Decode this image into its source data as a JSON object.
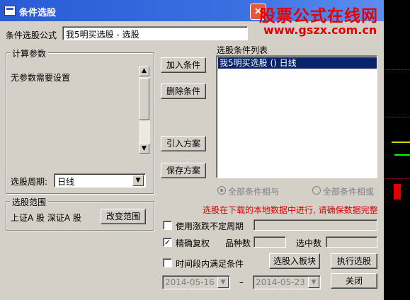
{
  "window": {
    "title": "条件选股",
    "close_label": "×"
  },
  "watermark": {
    "line1": "股票公式在线网",
    "line2": "www.gszx.com.cn"
  },
  "formula": {
    "label": "条件选股公式",
    "value": "我5明买选股 - 选股"
  },
  "params": {
    "group_label": "计算参数",
    "message": "无参数需要设置",
    "period_label": "选股周期:",
    "period_value": "日线"
  },
  "buttons": {
    "add": "加入条件",
    "delete": "删除条件",
    "import": "引入方案",
    "save": "保存方案",
    "change_range": "改变范围",
    "to_block": "选股入板块",
    "execute": "执行选股",
    "close": "关闭"
  },
  "condition_list": {
    "label": "选股条件列表",
    "items": [
      "我5明买选股  ()  日线"
    ]
  },
  "logic": {
    "and_label": "全部条件相与",
    "or_label": "全部条件相或"
  },
  "range": {
    "group_label": "选股范围",
    "value": "上证A 股  深证A 股"
  },
  "notice": "选股在下载的本地数据中进行, 请确保数据完整",
  "options": {
    "uncertain_period": "使用涨跌不定周期",
    "precise_restore": "精确复权",
    "time_range": "时间段内满足条件"
  },
  "stats": {
    "count_label": "品种数",
    "selected_label": "选中数"
  },
  "dates": {
    "start": "2014-05-16",
    "separator": "–",
    "end": "2014-05-23"
  },
  "icons": {
    "title": "window-icon",
    "scroll_up": "▲",
    "scroll_down": "▼",
    "dropdown": "▼"
  },
  "colors": {
    "title_bar": "#2a5bd6",
    "accent": "#e60000",
    "selection": "#0a246a"
  }
}
